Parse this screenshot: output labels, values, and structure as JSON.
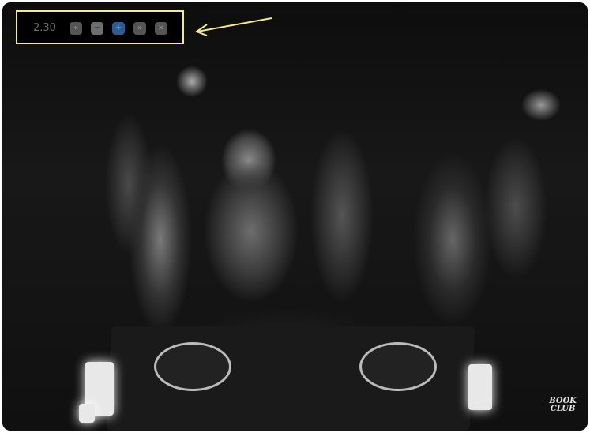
{
  "toolbar": {
    "zoom_value": "2.30",
    "buttons": [
      {
        "name": "fast-rewind",
        "glyph": "«"
      },
      {
        "name": "zoom-out",
        "glyph": "−"
      },
      {
        "name": "zoom-in",
        "glyph": "+"
      },
      {
        "name": "fast-forward",
        "glyph": "»"
      },
      {
        "name": "close",
        "glyph": "×"
      }
    ],
    "highlight_color": "#f2ea8c",
    "active_color": "#2a5d93"
  },
  "photo": {
    "logo_text": [
      "BOOK",
      "CLUB"
    ]
  }
}
